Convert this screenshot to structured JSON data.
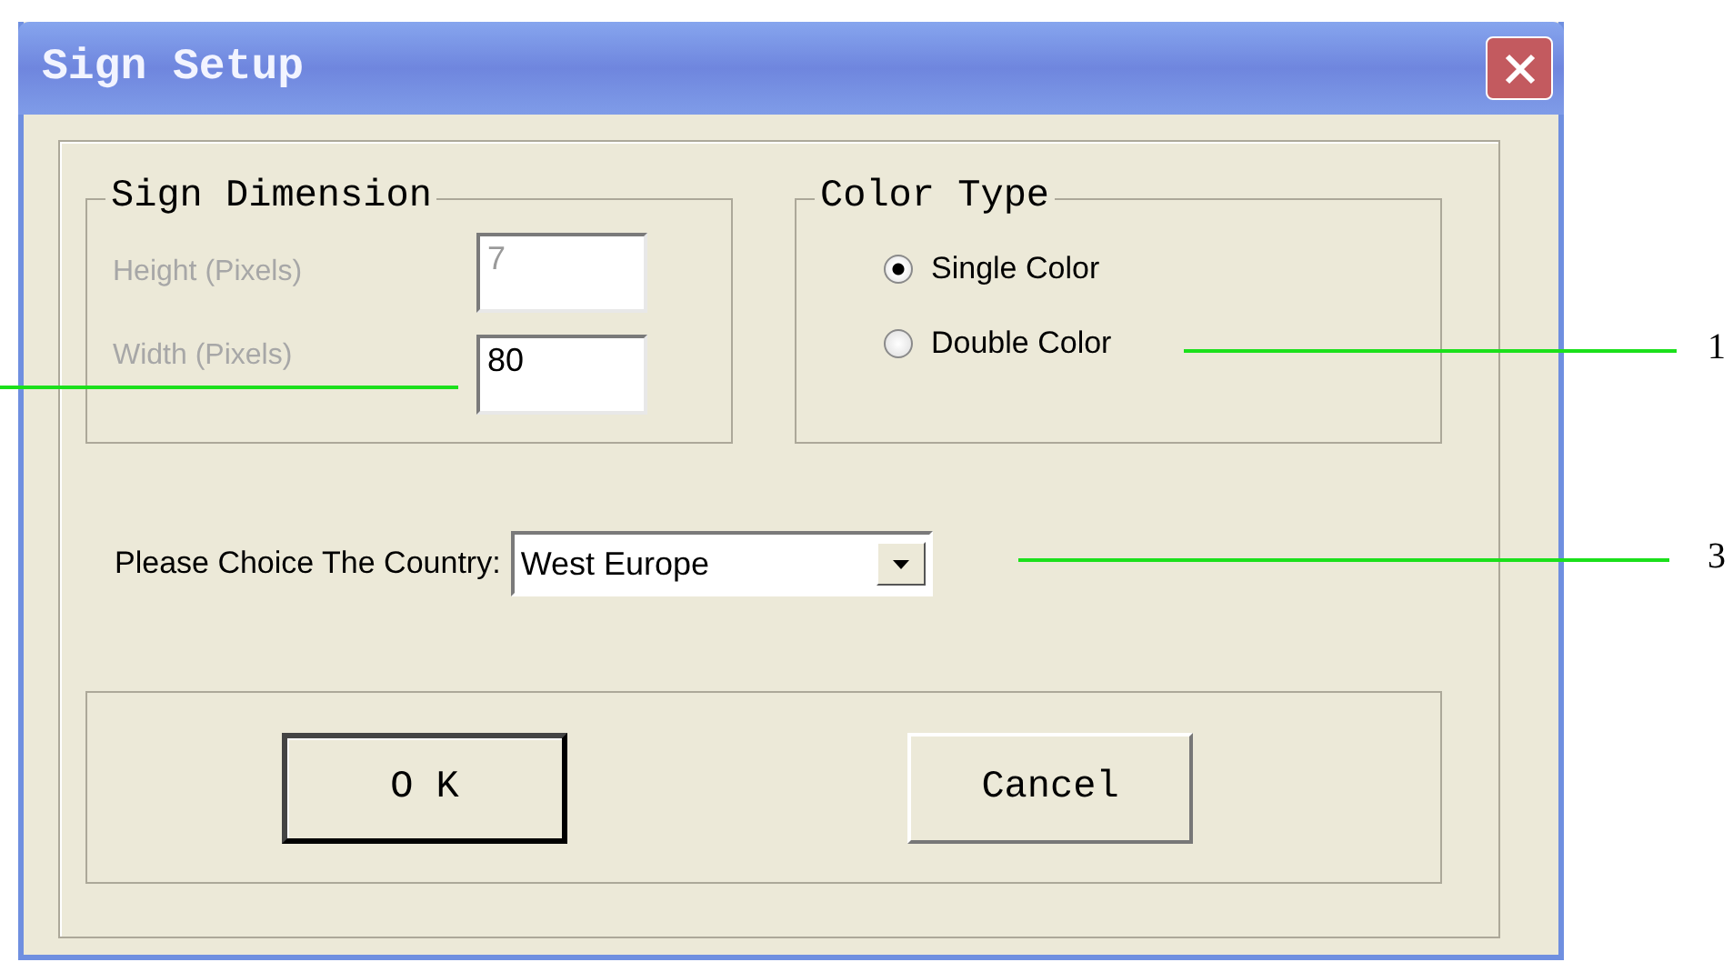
{
  "window": {
    "title": "Sign Setup"
  },
  "sign_dimension": {
    "title": "Sign Dimension",
    "fields": [
      {
        "label": "Height (Pixels)",
        "value": "7",
        "disabled": true
      },
      {
        "label": "Width (Pixels)",
        "value": "80",
        "disabled": false
      }
    ]
  },
  "color_type": {
    "title": "Color Type",
    "options": [
      {
        "label": "Single Color",
        "selected": true
      },
      {
        "label": "Double Color",
        "selected": false
      }
    ]
  },
  "country": {
    "label": "Please Choice The Country:",
    "value": "West Europe"
  },
  "buttons": [
    {
      "label": "O K",
      "default": true
    },
    {
      "label": "Cancel",
      "default": false
    }
  ],
  "callouts": [
    {
      "label": "1"
    },
    {
      "label": "3"
    }
  ]
}
